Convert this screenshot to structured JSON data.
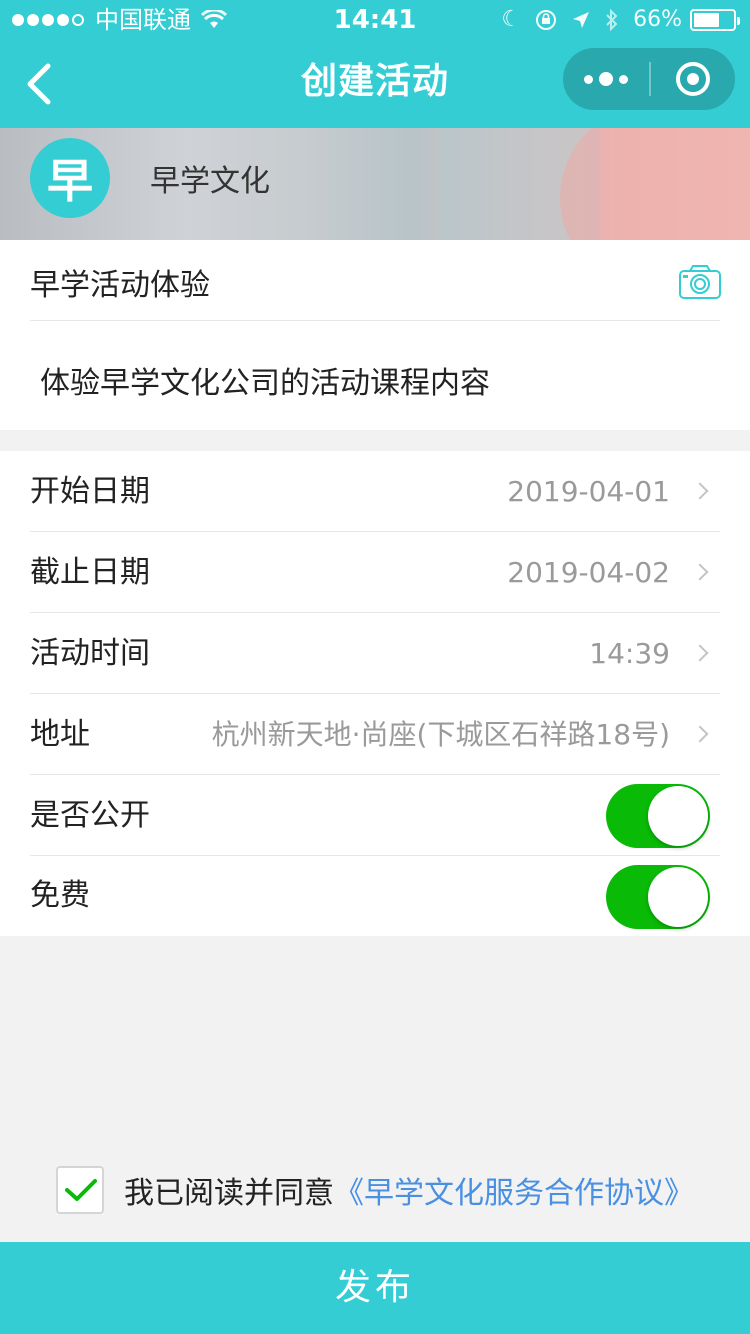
{
  "status_bar": {
    "carrier": "中国联通",
    "time": "14:41",
    "battery": "66%",
    "battery_level": 0.66
  },
  "nav": {
    "title": "创建活动"
  },
  "banner": {
    "logo_char": "早",
    "org_name": "早学文化"
  },
  "activity": {
    "title": "早学活动体验",
    "description": "体验早学文化公司的活动课程内容"
  },
  "form": {
    "rows": [
      {
        "label": "开始日期",
        "value": "2019-04-01"
      },
      {
        "label": "截止日期",
        "value": "2019-04-02"
      },
      {
        "label": "活动时间",
        "value": "14:39"
      },
      {
        "label": "地址",
        "value": "杭州新天地·尚座(下城区石祥路18号)"
      }
    ],
    "toggles": [
      {
        "label": "是否公开",
        "on": true
      },
      {
        "label": "免费",
        "on": true
      }
    ]
  },
  "agreement": {
    "checked": true,
    "text": "我已阅读并同意",
    "link": "《早学文化服务合作协议》"
  },
  "publish_label": "发布",
  "colors": {
    "primary": "#33cdd3",
    "switch_on": "#09bb07",
    "link": "#4a90e2"
  }
}
